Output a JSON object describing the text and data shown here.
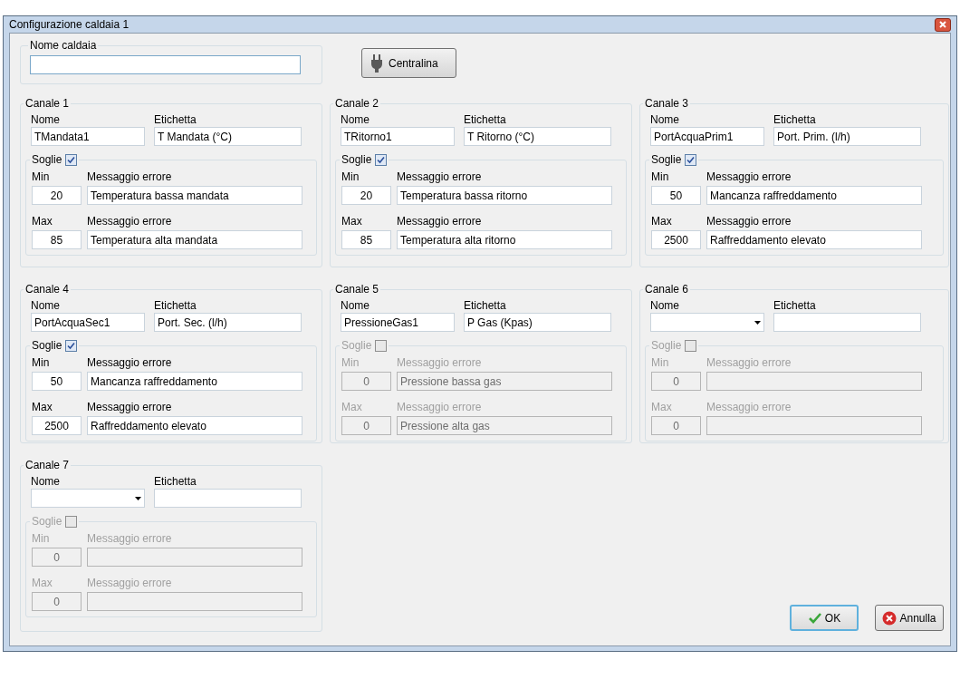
{
  "window": {
    "title": "Configurazione caldaia 1"
  },
  "boiler_name": {
    "label": "Nome caldaia"
  },
  "centralina_button": {
    "label": "Centralina"
  },
  "channels": [
    {
      "title": "Canale 1",
      "name_label": "Nome",
      "name_field": {
        "kind": "text",
        "value": "TMandata1"
      },
      "tag_label": "Etichetta",
      "tag": "T Mandata (°C)",
      "thresholds_label": "Soglie",
      "thresholds_checked": true,
      "min_label": "Min",
      "min": "20",
      "min_msg_label": "Messaggio errore",
      "min_msg": "Temperatura bassa mandata",
      "max_label": "Max",
      "max": "85",
      "max_msg_label": "Messaggio errore",
      "max_msg": "Temperatura alta mandata"
    },
    {
      "title": "Canale 2",
      "name_label": "Nome",
      "name_field": {
        "kind": "text",
        "value": "TRitorno1"
      },
      "tag_label": "Etichetta",
      "tag": "T Ritorno (°C)",
      "thresholds_label": "Soglie",
      "thresholds_checked": true,
      "min_label": "Min",
      "min": "20",
      "min_msg_label": "Messaggio errore",
      "min_msg": "Temperatura bassa ritorno",
      "max_label": "Max",
      "max": "85",
      "max_msg_label": "Messaggio errore",
      "max_msg": "Temperatura alta ritorno"
    },
    {
      "title": "Canale 3",
      "name_label": "Nome",
      "name_field": {
        "kind": "text",
        "value": "PortAcquaPrim1"
      },
      "tag_label": "Etichetta",
      "tag": "Port. Prim. (l/h)",
      "thresholds_label": "Soglie",
      "thresholds_checked": true,
      "min_label": "Min",
      "min": "50",
      "min_msg_label": "Messaggio errore",
      "min_msg": "Mancanza raffreddamento",
      "max_label": "Max",
      "max": "2500",
      "max_msg_label": "Messaggio errore",
      "max_msg": "Raffreddamento elevato"
    },
    {
      "title": "Canale 4",
      "name_label": "Nome",
      "name_field": {
        "kind": "text",
        "value": "PortAcquaSec1"
      },
      "tag_label": "Etichetta",
      "tag": "Port. Sec. (l/h)",
      "thresholds_label": "Soglie",
      "thresholds_checked": true,
      "min_label": "Min",
      "min": "50",
      "min_msg_label": "Messaggio errore",
      "min_msg": "Mancanza raffreddamento",
      "max_label": "Max",
      "max": "2500",
      "max_msg_label": "Messaggio errore",
      "max_msg": "Raffreddamento elevato"
    },
    {
      "title": "Canale 5",
      "name_label": "Nome",
      "name_field": {
        "kind": "text",
        "value": "PressioneGas1"
      },
      "tag_label": "Etichetta",
      "tag": "P Gas (Kpas)",
      "thresholds_label": "Soglie",
      "thresholds_checked": false,
      "min_label": "Min",
      "min": "0",
      "min_msg_label": "Messaggio errore",
      "min_msg": "Pressione bassa gas",
      "max_label": "Max",
      "max": "0",
      "max_msg_label": "Messaggio errore",
      "max_msg": "Pressione alta gas"
    },
    {
      "title": "Canale 6",
      "name_label": "Nome",
      "name_field": {
        "kind": "combo"
      },
      "tag_label": "Etichetta",
      "thresholds_label": "Soglie",
      "thresholds_checked": false,
      "min_label": "Min",
      "min": "0",
      "min_msg_label": "Messaggio errore",
      "max_label": "Max",
      "max": "0",
      "max_msg_label": "Messaggio errore"
    },
    {
      "title": "Canale 7",
      "name_label": "Nome",
      "name_field": {
        "kind": "combo"
      },
      "tag_label": "Etichetta",
      "thresholds_label": "Soglie",
      "thresholds_checked": false,
      "min_label": "Min",
      "min": "0",
      "min_msg_label": "Messaggio errore",
      "max_label": "Max",
      "max": "0",
      "max_msg_label": "Messaggio errore"
    }
  ],
  "buttons": [
    {
      "kind": "ok",
      "label": "OK"
    },
    {
      "kind": "cancel",
      "label": "Annulla"
    }
  ]
}
